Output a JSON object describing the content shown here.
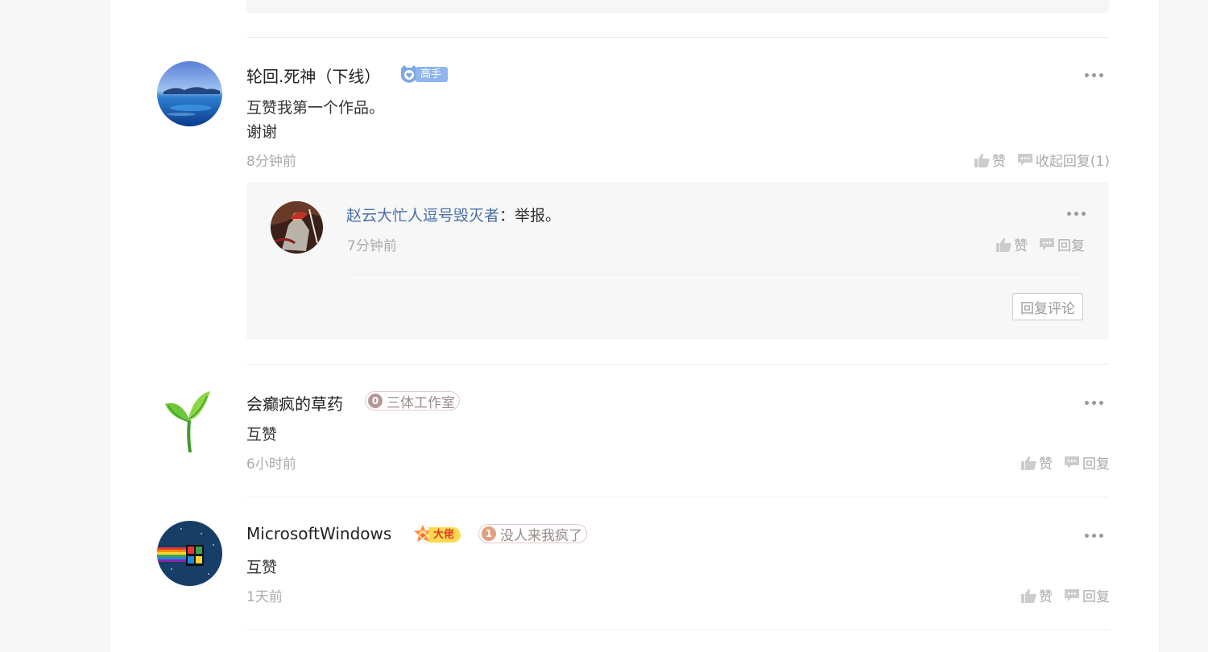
{
  "comments": [
    {
      "name": "轮回.死神（下线）",
      "rank_badge": {
        "label": "高手",
        "color": "#7fa7e8",
        "icon": "shield-heart-icon"
      },
      "text_lines": [
        "互赞我第一个作品。",
        "谢谢"
      ],
      "time": "8分钟前",
      "like_label": "赞",
      "reply_label": "收起回复(1)",
      "avatar": "ocean-island-avatar",
      "replies": [
        {
          "author": "赵云大忙人逗号毁灭者",
          "separator": "：",
          "text": "举报。",
          "time": "7分钟前",
          "like_label": "赞",
          "reply_label": "回复",
          "avatar": "warrior-avatar"
        }
      ],
      "reply_comment_button": "回复评论"
    },
    {
      "name": "会癫疯的草药",
      "level_badge": {
        "number": "0",
        "label": "三体工作室",
        "color": "#b49898"
      },
      "text_lines": [
        "互赞"
      ],
      "time": "6小时前",
      "like_label": "赞",
      "reply_label": "回复",
      "avatar": "sprout-avatar"
    },
    {
      "name": "MicrosoftWindows",
      "rank_badge": {
        "label": "大佬",
        "color": "#f5c518",
        "icon": "crown-star-icon"
      },
      "level_badge": {
        "number": "1",
        "label": "没人来我疯了",
        "color": "#e0a080"
      },
      "text_lines": [
        "互赞"
      ],
      "time": "1天前",
      "like_label": "赞",
      "reply_label": "回复",
      "avatar": "windows-rainbow-avatar"
    }
  ],
  "colors": {
    "link": "#4a6fa5",
    "muted": "#aaaaaa",
    "divider": "#eeeeee",
    "reply_bg": "#f7f7f7"
  }
}
